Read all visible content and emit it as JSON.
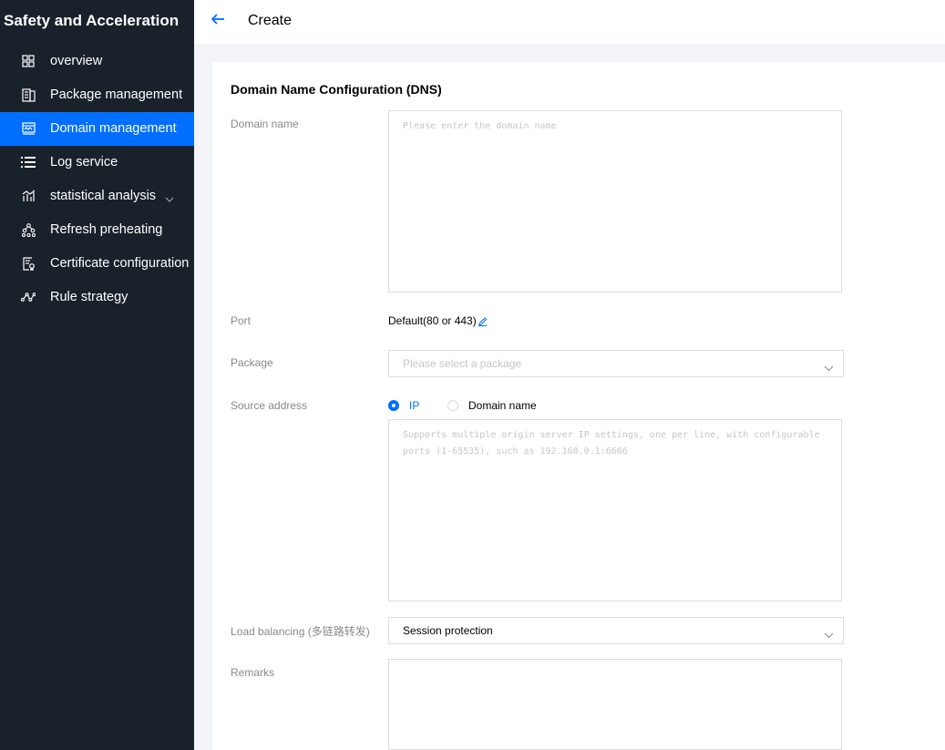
{
  "sidebar": {
    "title": "Safety and Acceleration",
    "items": [
      {
        "label": "overview",
        "icon": "grid-icon"
      },
      {
        "label": "Package management",
        "icon": "package-icon"
      },
      {
        "label": "Domain management",
        "icon": "domain-icon",
        "active": true
      },
      {
        "label": "Log service",
        "icon": "list-icon"
      },
      {
        "label": "statistical analysis",
        "icon": "chart-icon",
        "expandable": true
      },
      {
        "label": "Refresh preheating",
        "icon": "hierarchy-icon"
      },
      {
        "label": "Certificate configuration",
        "icon": "certificate-icon"
      },
      {
        "label": "Rule strategy",
        "icon": "route-icon"
      }
    ]
  },
  "header": {
    "title": "Create"
  },
  "form": {
    "section_title": "Domain Name Configuration (DNS)",
    "domain_name": {
      "label": "Domain name",
      "placeholder": "Please enter the domain name",
      "value": ""
    },
    "port": {
      "label": "Port",
      "value": "Default(80 or 443)"
    },
    "package": {
      "label": "Package",
      "placeholder": "Please select a package"
    },
    "source_address": {
      "label": "Source address",
      "options": [
        "IP",
        "Domain name"
      ],
      "selected": "IP",
      "placeholder": "Supports multiple origin server IP settings, one per line, with configurable ports (1-65535), such as 192.168.0.1:6666"
    },
    "load_balancing": {
      "label": "Load balancing (多链路转发)",
      "value": "Session protection"
    },
    "remarks": {
      "label": "Remarks",
      "value": ""
    }
  },
  "colors": {
    "sidebar_bg": "#19212b",
    "accent": "#006eff",
    "page_bg": "#f3f4f7",
    "label_gray": "#888888",
    "placeholder_gray": "#c6c6c6",
    "border_gray": "#dcdcdc"
  }
}
